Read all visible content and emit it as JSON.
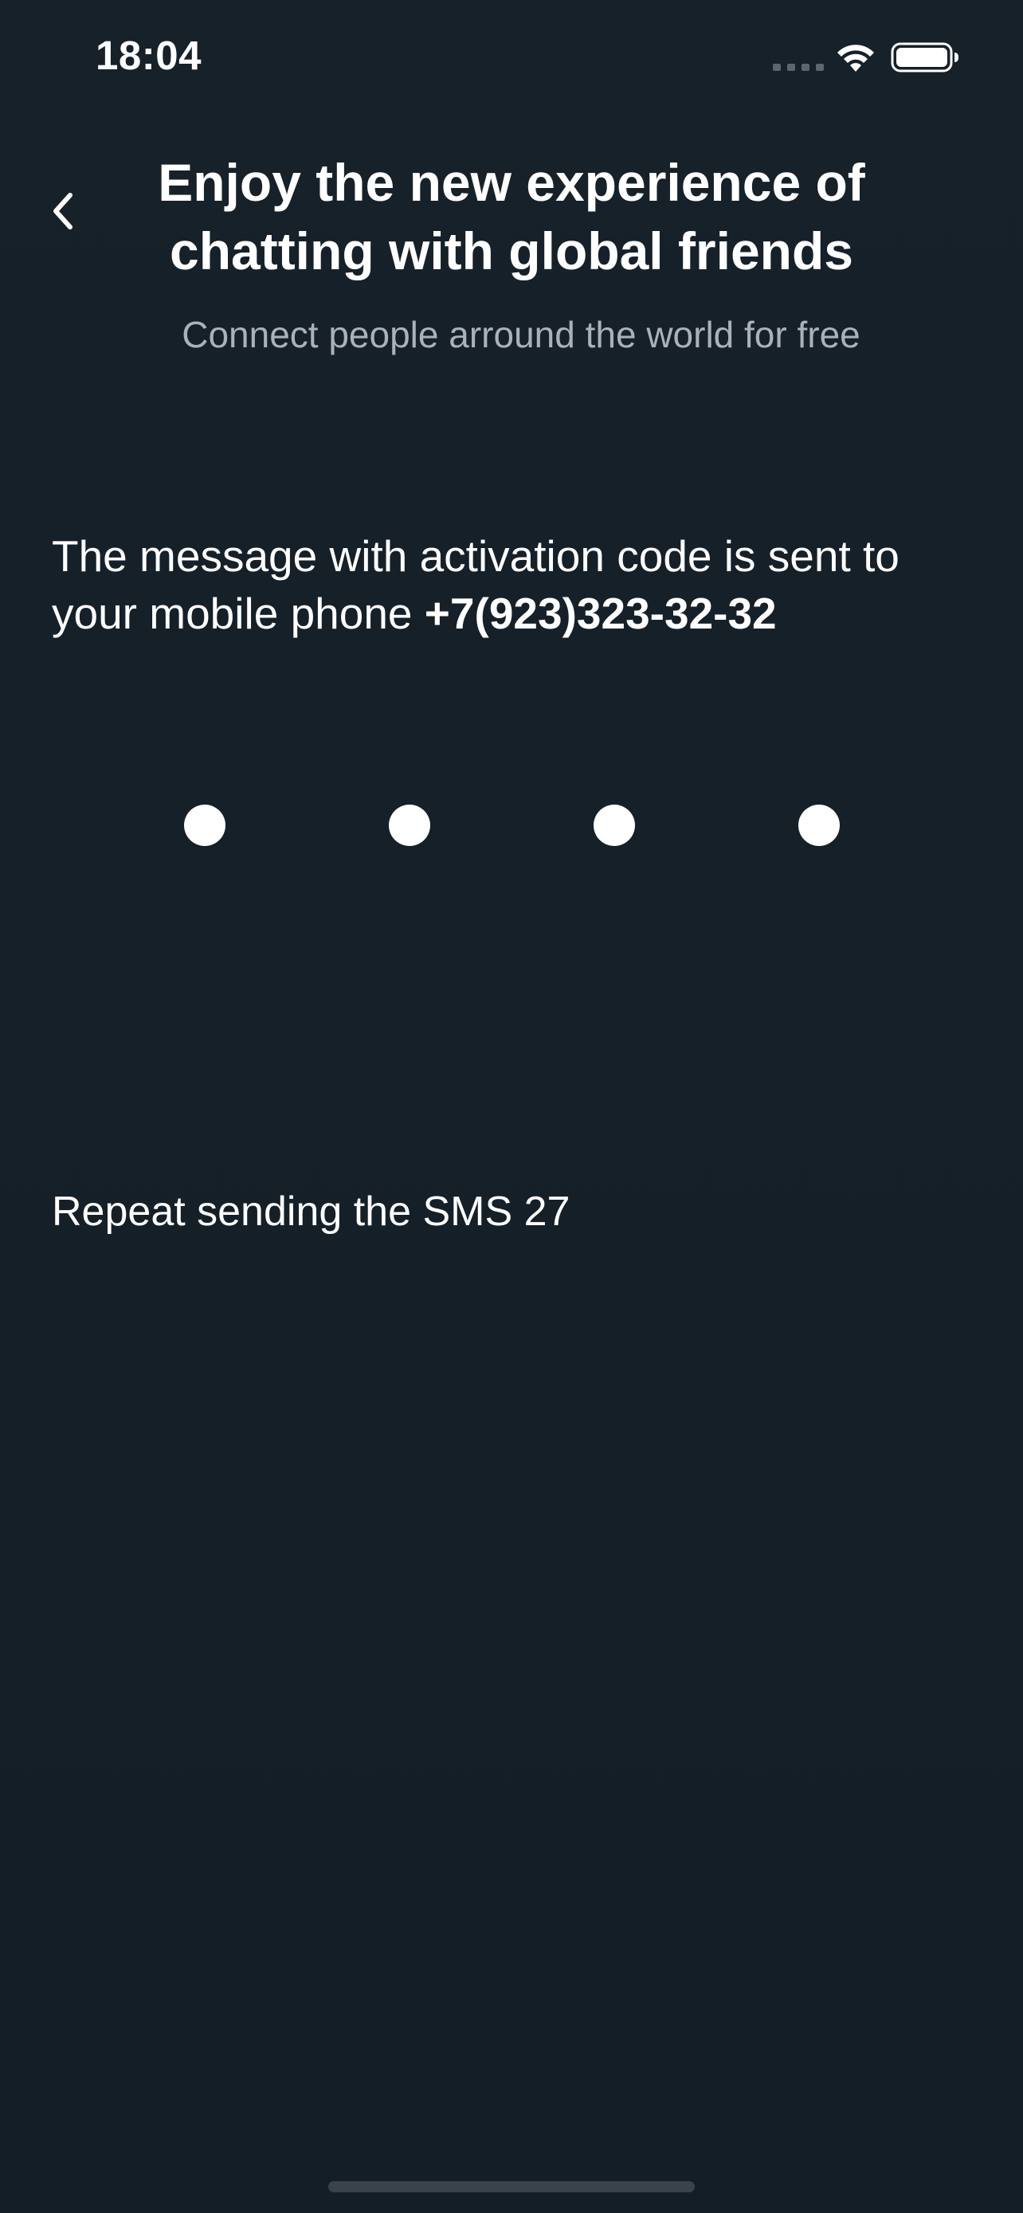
{
  "status_bar": {
    "time": "18:04"
  },
  "header": {
    "title": "Enjoy the new experience of chatting with global friends",
    "subtitle": "Connect people arround the world for free"
  },
  "verification": {
    "message": "The message with activation code is sent to your mobile phone ",
    "phone": "+7(923)323-32-32",
    "code_length": 4,
    "filled_digits": 4
  },
  "repeat": {
    "label": "Repeat sending the SMS",
    "countdown": "27"
  },
  "icons": {
    "back": "chevron-left-icon",
    "signal": "cell-signal-icon",
    "wifi": "wifi-icon",
    "battery": "battery-icon"
  },
  "colors": {
    "background": "#162028",
    "text": "#ffffff",
    "subtitle": "#aab1b8"
  }
}
